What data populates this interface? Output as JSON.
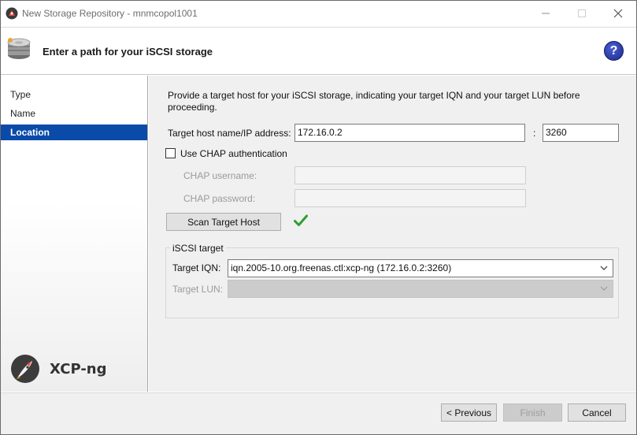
{
  "window": {
    "title": "New Storage Repository - mnmcopol1001"
  },
  "header": {
    "heading": "Enter a path for your iSCSI storage",
    "help_label": "?"
  },
  "nav": {
    "items": [
      {
        "label": "Type"
      },
      {
        "label": "Name"
      },
      {
        "label": "Location",
        "active": true
      }
    ],
    "brand": "XCP-ng"
  },
  "main": {
    "intro": "Provide a target host for your iSCSI storage, indicating your target IQN and your target LUN before proceeding.",
    "host_label": "Target host name/IP address:",
    "host_value": "172.16.0.2",
    "port_separator": ":",
    "port_value": "3260",
    "chap_label": "Use CHAP authentication",
    "chap_checked": false,
    "chap_user_label": "CHAP username:",
    "chap_user_value": "",
    "chap_pass_label": "CHAP password:",
    "chap_pass_value": "",
    "scan_button": "Scan Target Host",
    "scan_status_icon": "green-check-icon",
    "iscsi_group": "iSCSI target",
    "iqn_label": "Target IQN:",
    "iqn_value": "iqn.2005-10.org.freenas.ctl:xcp-ng (172.16.0.2:3260)",
    "lun_label": "Target LUN:",
    "lun_value": ""
  },
  "footer": {
    "previous": "< Previous",
    "finish": "Finish",
    "cancel": "Cancel"
  },
  "colors": {
    "accent": "#0a4aa8",
    "check": "#2e9e2e",
    "help": "#1c2a8e"
  }
}
